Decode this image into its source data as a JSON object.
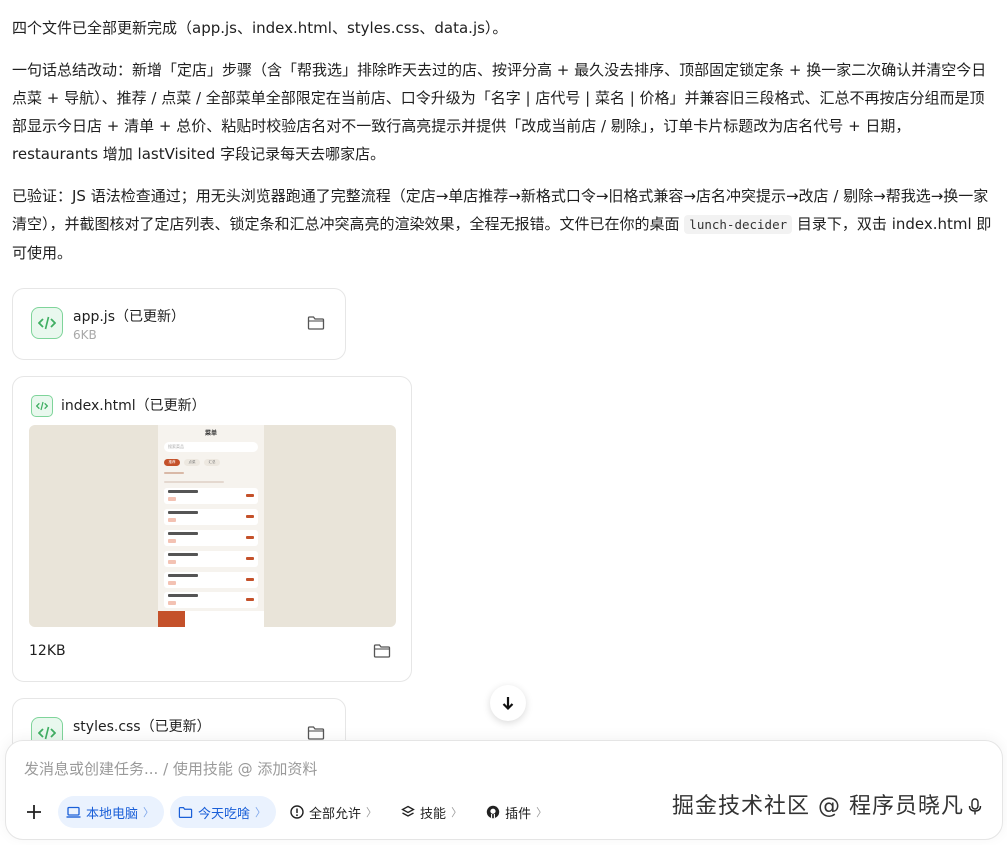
{
  "message": {
    "p1": "四个文件已全部更新完成（app.js、index.html、styles.css、data.js）。",
    "p2": "一句话总结改动：新增「定店」步骤（含「帮我选」排除昨天去过的店、按评分高 + 最久没去排序、顶部固定锁定条 + 换一家二次确认并清空今日点菜 + 导航）、推荐 / 点菜 / 全部菜单全部限定在当前店、口令升级为「名字 | 店代号 | 菜名 | 价格」并兼容旧三段格式、汇总不再按店分组而是顶部显示今日店 + 清单 + 总价、粘贴时校验店名对不一致行高亮提示并提供「改成当前店 / 剔除」，订单卡片标题改为店名代号 + 日期，restaurants 增加 lastVisited 字段记录每天去哪家店。",
    "p3_before": "已验证：JS 语法检查通过；用无头浏览器跑通了完整流程（定店→单店推荐→新格式口令→旧格式兼容→店名冲突提示→改店 / 剔除→帮我选→换一家清空），并截图核对了定店列表、锁定条和汇总冲突高亮的渲染效果，全程无报错。文件已在你的桌面",
    "p3_code": "lunch-decider",
    "p3_after": "目录下，双击 index.html 即可使用。"
  },
  "files": [
    {
      "name": "app.js（已更新）",
      "size": "6KB"
    },
    {
      "name": "index.html（已更新）",
      "size": "12KB"
    },
    {
      "name": "styles.css（已更新）"
    }
  ],
  "preview": {
    "title": "菜单",
    "search_placeholder": "搜索菜品",
    "tabs": [
      "推荐",
      "点菜",
      "汇总"
    ]
  },
  "composer": {
    "placeholder": "发消息或创建任务... / 使用技能 @ 添加资料",
    "chips": [
      {
        "label": "本地电脑",
        "icon": "laptop-icon"
      },
      {
        "label": "今天吃啥",
        "icon": "folder-icon"
      },
      {
        "label": "全部允许",
        "icon": "alert-circle-icon"
      },
      {
        "label": "技能",
        "icon": "layers-icon"
      },
      {
        "label": "插件",
        "icon": "github-icon"
      }
    ]
  },
  "watermark": "掘金技术社区 @ 程序员晓凡",
  "colors": {
    "accent": "#1a5fd8",
    "file_icon": "#7fd49a",
    "preview_accent": "#c4512a"
  }
}
